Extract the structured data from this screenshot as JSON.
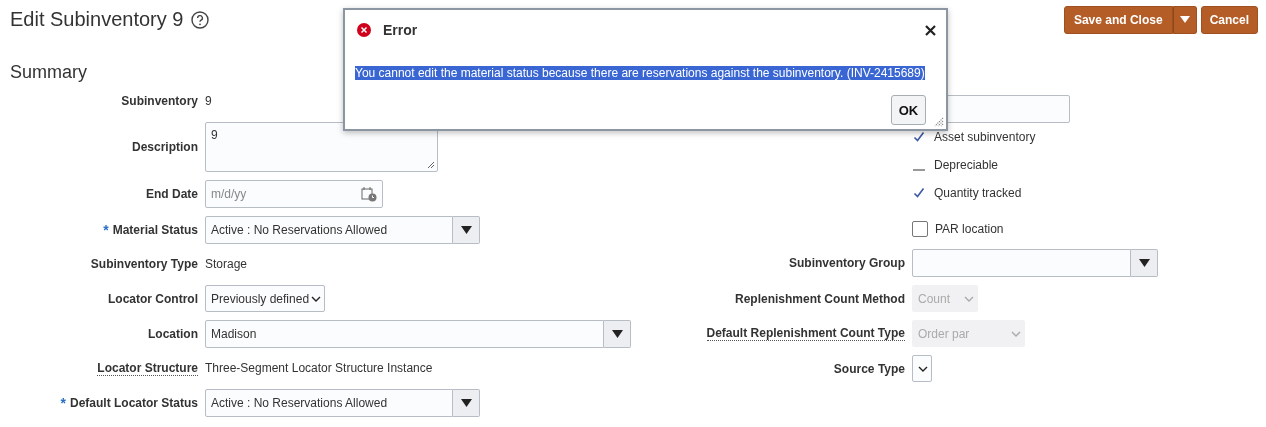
{
  "page": {
    "title": "Edit Subinventory 9"
  },
  "actions": [
    {
      "label": "Save and Close",
      "kind": "split"
    },
    {
      "label": "Cancel",
      "kind": "button"
    }
  ],
  "section": {
    "title": "Summary"
  },
  "left_fields": [
    {
      "label": "Subinventory",
      "kind": "text",
      "value": "9",
      "has_help": false
    },
    {
      "label": "Description",
      "kind": "textarea",
      "value": "9",
      "has_help": false
    },
    {
      "label": "End Date",
      "kind": "date",
      "placeholder": "m/d/yy",
      "has_help": false
    },
    {
      "label": "Material Status",
      "kind": "combo",
      "value": "Active : No Reservations Allowed",
      "required_mark": "*",
      "has_help": false
    },
    {
      "label": "Subinventory Type",
      "kind": "text",
      "value": "Storage",
      "has_help": false
    },
    {
      "label": "Locator Control",
      "kind": "select",
      "value": "Previously defined",
      "has_help": false,
      "disabled": false
    },
    {
      "label": "Location",
      "kind": "combo",
      "value": "Madison",
      "has_help": false
    },
    {
      "label": "Locator Structure",
      "kind": "text",
      "value": "Three-Segment Locator Structure Instance",
      "has_help": true
    },
    {
      "label": "Default Locator Status",
      "kind": "combo",
      "value": "Active : No Reservations Allowed",
      "required_mark": "*",
      "has_help": false
    }
  ],
  "right_checks": [
    {
      "label": "Asset subinventory",
      "checked": true
    },
    {
      "label": "Depreciable",
      "checked": false
    },
    {
      "label": "Quantity tracked",
      "checked": true
    }
  ],
  "par_location": {
    "label": "PAR location",
    "checked": false
  },
  "right_fields": [
    {
      "label": "Subinventory Group",
      "kind": "combo",
      "has_help": false
    },
    {
      "label": "Replenishment Count Method",
      "kind": "select",
      "value": "Count",
      "disabled": true,
      "has_help": false
    },
    {
      "label": "Default Replenishment Count Type",
      "kind": "select",
      "value": "Order par",
      "disabled": true,
      "has_help": true
    },
    {
      "label": "Source Type",
      "kind": "select",
      "disabled": false,
      "has_help": false
    }
  ],
  "dialog": {
    "title": "Error",
    "message": "You cannot edit the material status because there are reservations against the subinventory. (INV-2415689)",
    "button": "OK"
  }
}
